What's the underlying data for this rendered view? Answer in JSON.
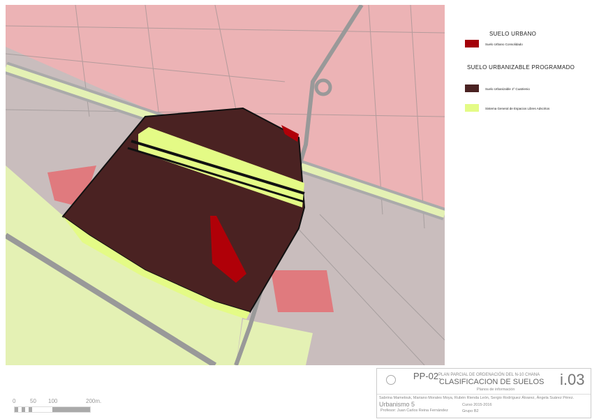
{
  "legend": {
    "urbano_title": "SUELO URBANO",
    "urbano_items": [
      {
        "label": "Suelo Urbano Consolidado",
        "color": "#a30008"
      }
    ],
    "urbanizable_title": "SUELO URBANIZABLE PROGRAMADO",
    "urbanizable_items": [
      {
        "label": "Suelo Urbanizable 1º Cuatrienio",
        "color": "#4a2222"
      },
      {
        "label": "Sistema General de Espacios Libres Adscritos",
        "color": "#e4fb86"
      }
    ]
  },
  "title_block": {
    "code": "PP-02.",
    "subtitle": "PLAN PARCIAL DE ORDENACIÓN DEL N-10 CHANA",
    "title": "CLASIFICACION DE SUELOS",
    "section": "Planos de información",
    "sheet": "i.03",
    "authors": "Sabrina Mamelouk, Mariano Morales Moya, Rubén Rienda León, Sergio Rodríguez Álvarez, Ángela Suárez Pérez.",
    "course": "Urbanismo 5",
    "professor": "Profesor: Juan Carlos Reina Fernández",
    "year": "Curso 2015-2016",
    "group": "Grupo B2"
  },
  "scale": {
    "ticks": [
      "0",
      "50",
      "100",
      "200m."
    ]
  }
}
